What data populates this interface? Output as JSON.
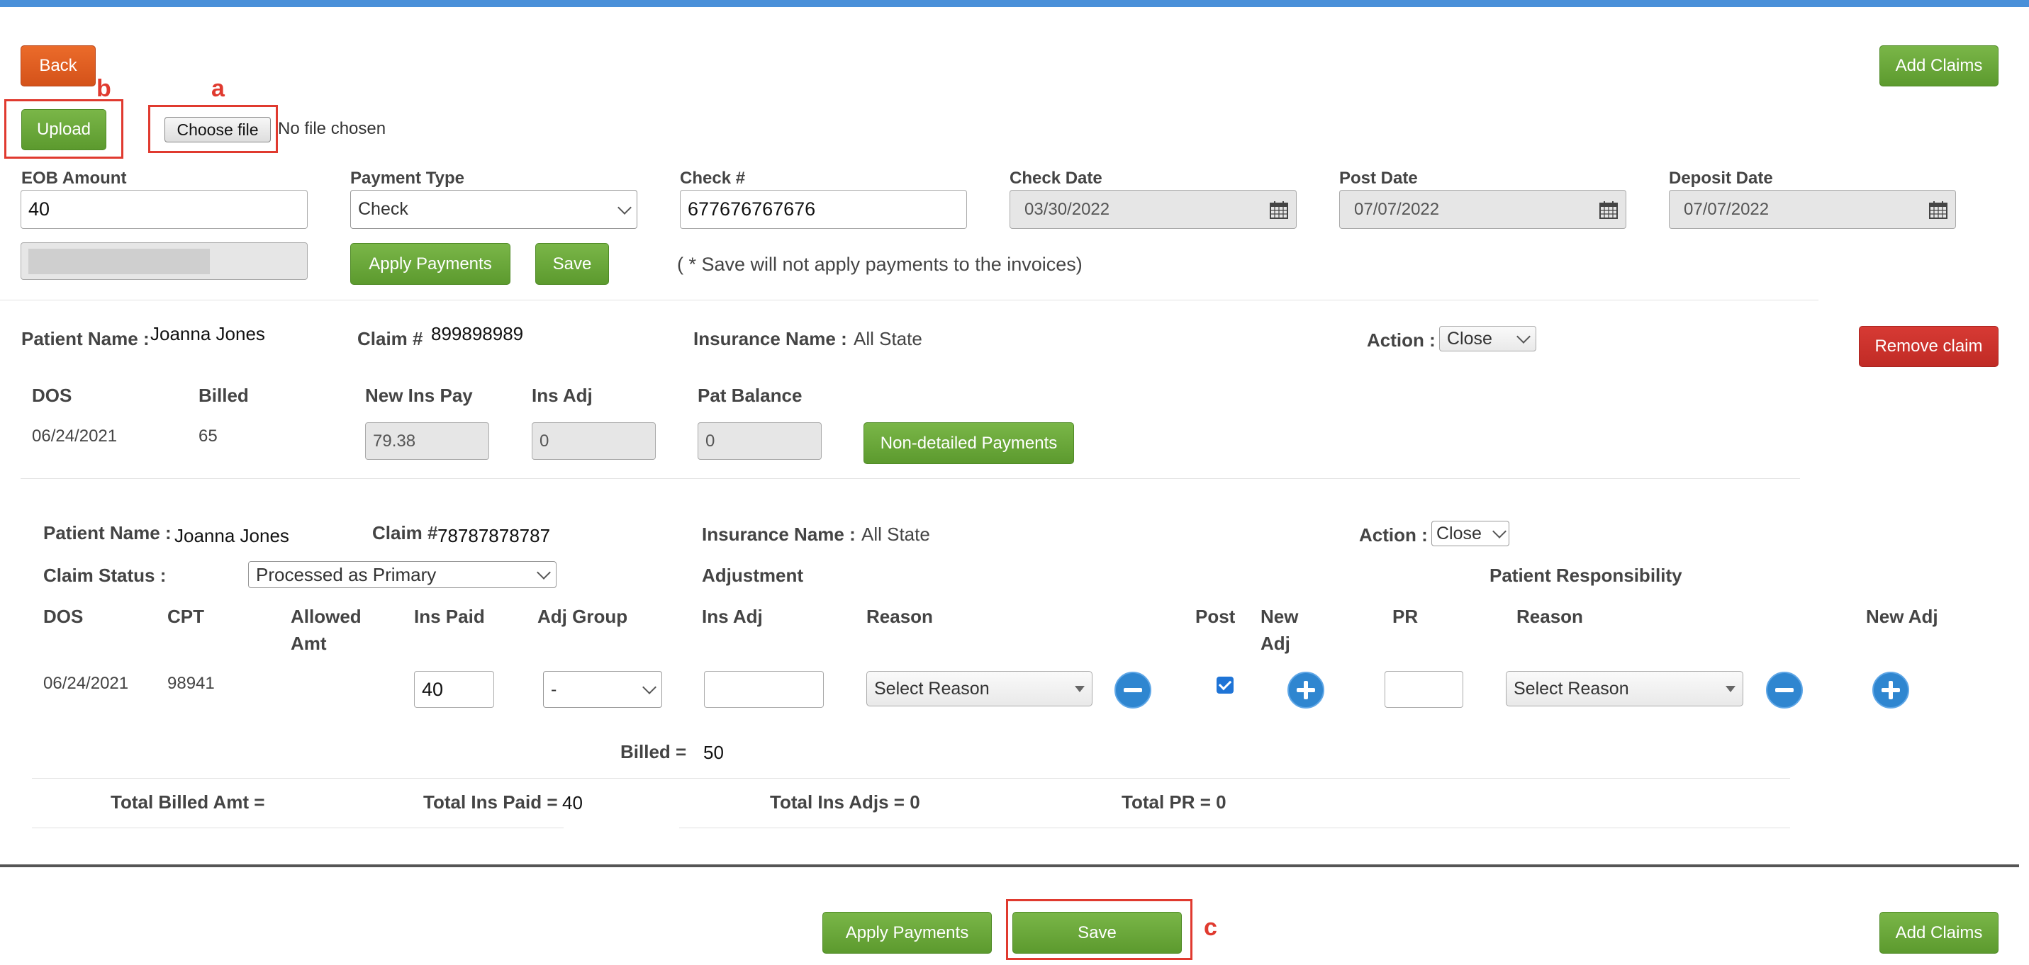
{
  "toolbar": {
    "back_label": "Back",
    "add_claims_label": "Add Claims",
    "upload_label": "Upload",
    "choose_file_label": "Choose file",
    "file_status": "No file chosen"
  },
  "annotations": {
    "a": "a",
    "b": "b",
    "c": "c"
  },
  "payment": {
    "eob_amount_label": "EOB Amount",
    "eob_amount_value": "40",
    "payment_type_label": "Payment Type",
    "payment_type_value": "Check",
    "check_no_label": "Check #",
    "check_no_value": "677676767676",
    "check_date_label": "Check Date",
    "check_date_value": "03/30/2022",
    "post_date_label": "Post Date",
    "post_date_value": "07/07/2022",
    "deposit_date_label": "Deposit Date",
    "deposit_date_value": "07/07/2022",
    "apply_payments_label": "Apply Payments",
    "save_label": "Save",
    "save_note": "( * Save will not apply payments to the invoices)"
  },
  "claim1": {
    "patient_name_label": "Patient Name :",
    "patient_name": "Joanna Jones",
    "claim_no_label": "Claim #",
    "claim_no": "899898989",
    "insurance_label": "Insurance Name :",
    "insurance_name": "All State",
    "action_label": "Action :",
    "action_value": "Close",
    "remove_label": "Remove claim",
    "headers": {
      "dos": "DOS",
      "billed": "Billed",
      "new_ins_pay": "New Ins Pay",
      "ins_adj": "Ins Adj",
      "pat_balance": "Pat Balance"
    },
    "row": {
      "dos": "06/24/2021",
      "billed": "65",
      "new_ins_pay": "79.38",
      "ins_adj": "0",
      "pat_balance": "0"
    },
    "non_detailed_label": "Non-detailed Payments"
  },
  "claim2": {
    "patient_name_label": "Patient Name :",
    "patient_name": "Joanna Jones",
    "claim_no_label": "Claim #",
    "claim_no": "78787878787",
    "insurance_label": "Insurance Name :",
    "insurance_name": "All State",
    "action_label": "Action :",
    "action_value": "Close",
    "claim_status_label": "Claim Status :",
    "claim_status_value": "Processed as Primary",
    "adjustment_label": "Adjustment",
    "patient_resp_label": "Patient Responsibility",
    "headers": {
      "dos": "DOS",
      "cpt": "CPT",
      "allowed_1": "Allowed",
      "allowed_2": "Amt",
      "ins_paid": "Ins Paid",
      "adj_group": "Adj Group",
      "ins_adj": "Ins Adj",
      "reason": "Reason",
      "post": "Post",
      "new_adj_1": "New",
      "new_adj_2": "Adj",
      "pr": "PR",
      "reason2": "Reason",
      "new_adj_right": "New Adj"
    },
    "row": {
      "dos": "06/24/2021",
      "cpt": "98941",
      "ins_paid": "40",
      "adj_group": "-",
      "ins_adj": "",
      "reason": "Select Reason",
      "post_checked": true,
      "pr": "",
      "reason2": "Select Reason"
    },
    "billed_label": "Billed =",
    "billed_value": "50",
    "totals": {
      "billed_label": "Total Billed Amt =",
      "ins_paid_label": "Total Ins Paid =",
      "ins_paid_value": "40",
      "ins_adjs": "Total Ins Adjs = 0",
      "pr": "Total PR = 0"
    }
  },
  "footer": {
    "apply_payments_label": "Apply Payments",
    "save_label": "Save",
    "add_claims_label": "Add Claims"
  }
}
